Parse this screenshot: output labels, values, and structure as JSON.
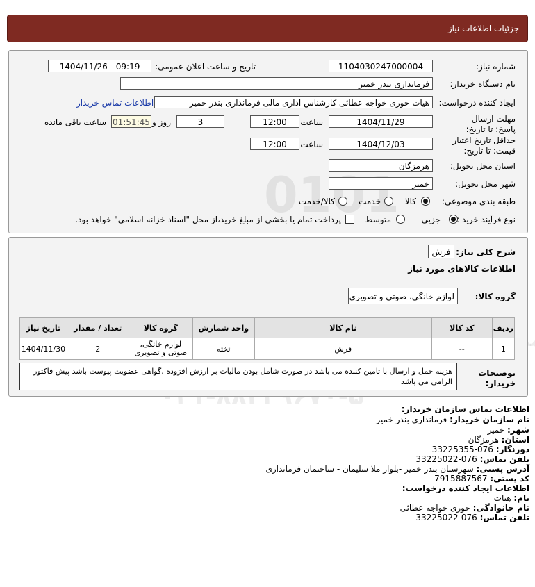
{
  "header": {
    "title": "جزئیات اطلاعات نیاز"
  },
  "form": {
    "need_number_label": "شماره نیاز:",
    "need_number": "1104030247000004",
    "announce_label": "تاریخ و ساعت اعلان عمومی:",
    "announce_value": "1404/11/26 - 09:19",
    "buyer_org_label": "نام دستگاه خریدار:",
    "buyer_org": "فرمانداری بندر خمیر",
    "creator_label": "ایجاد کننده درخواست:",
    "creator": "هیات  حوری خواجه عطائی کارشناس اداری مالی  فرمانداری بندر خمیر",
    "contact_link": "اطلاعات تماس خریدار",
    "deadline_label": "مهلت ارسال پاسخ: تا تاریخ:",
    "deadline_date": "1404/11/29",
    "time_label": "ساعت",
    "deadline_time": "12:00",
    "days_value": "3",
    "days_label": "روز و",
    "remaining_time": "01:51:45",
    "remaining_label": "ساعت باقی مانده",
    "validity_label": "حداقل تاریخ اعتبار قیمت: تا تاریخ:",
    "validity_date": "1404/12/03",
    "validity_time": "12:00",
    "province_label": "استان محل تحویل:",
    "province": "هرمزگان",
    "city_label": "شهر محل تحویل:",
    "city": "خمیر",
    "category_label": "طبقه بندی موضوعی:",
    "category_options": [
      "کالا",
      "خدمت",
      "کالا/خدمت"
    ],
    "process_label": "نوع فرآیند خرید :",
    "process_options": [
      "جزیی",
      "متوسط"
    ],
    "payment_note": "پرداخت تمام یا بخشی از مبلغ خرید،از محل \"اسناد خزانه اسلامی\" خواهد بود."
  },
  "summary": {
    "desc_label": "شرح کلی نیاز:",
    "desc_value": "فرش",
    "goods_info_title": "اطلاعات کالاهای مورد نیاز",
    "goods_group_label": "گروه کالا:",
    "goods_group": "لوازم خانگی، صوتی و تصویری"
  },
  "table": {
    "headers": [
      "ردیف",
      "کد کالا",
      "نام کالا",
      "واحد شمارش",
      "گروه کالا",
      "تعداد / مقدار",
      "تاریخ نیاز"
    ],
    "rows": [
      {
        "row": "1",
        "code": "--",
        "name": "فرش",
        "unit": "تخته",
        "group": "لوازم خانگی، صوتی و تصویری",
        "qty": "2",
        "date": "1404/11/30"
      }
    ]
  },
  "notes": {
    "label": "توضیحات خریدار:",
    "text": "هزینه حمل و ارسال با تامین کننده می باشد در صورت شامل بودن مالیات بر ارزش افزوده ،گواهی عضویت پیوست باشد پیش فاکتور الزامی می باشد"
  },
  "contact": {
    "title": "اطلاعات تماس سازمان خریدار:",
    "org_label": "نام سازمان خریدار:",
    "org": "فرمانداری بندر خمیر",
    "city_label": "شهر:",
    "city": "خمیر",
    "province_label": "استان:",
    "province": "هرمزگان",
    "fax_label": "دورنگار:",
    "fax": "076-33225355",
    "phone_label": "تلفن تماس:",
    "phone": "076-33225022",
    "address_label": "آدرس پستی:",
    "address": "شهرستان بندر خمیر -بلوار ملا سلیمان - ساختمان فرمانداری",
    "postal_label": "کد پستی:",
    "postal": "7915887567",
    "creator_title": "اطلاعات ایجاد کننده درخواست:",
    "name_label": "نام:",
    "name": "هیات",
    "family_label": "نام خانوادگی:",
    "family": "حوری خواجه عطائی",
    "creator_phone_label": "تلفن تماس:",
    "creator_phone": "076-33225022"
  },
  "watermark": {
    "brand": "ParsNamadData",
    "phone": "۰۲۱-۸۸۳۴۹۶۷۰-۵",
    "center": "مرکز فناوری اطلاعات پارس نماد داده",
    "digits": "0101"
  }
}
